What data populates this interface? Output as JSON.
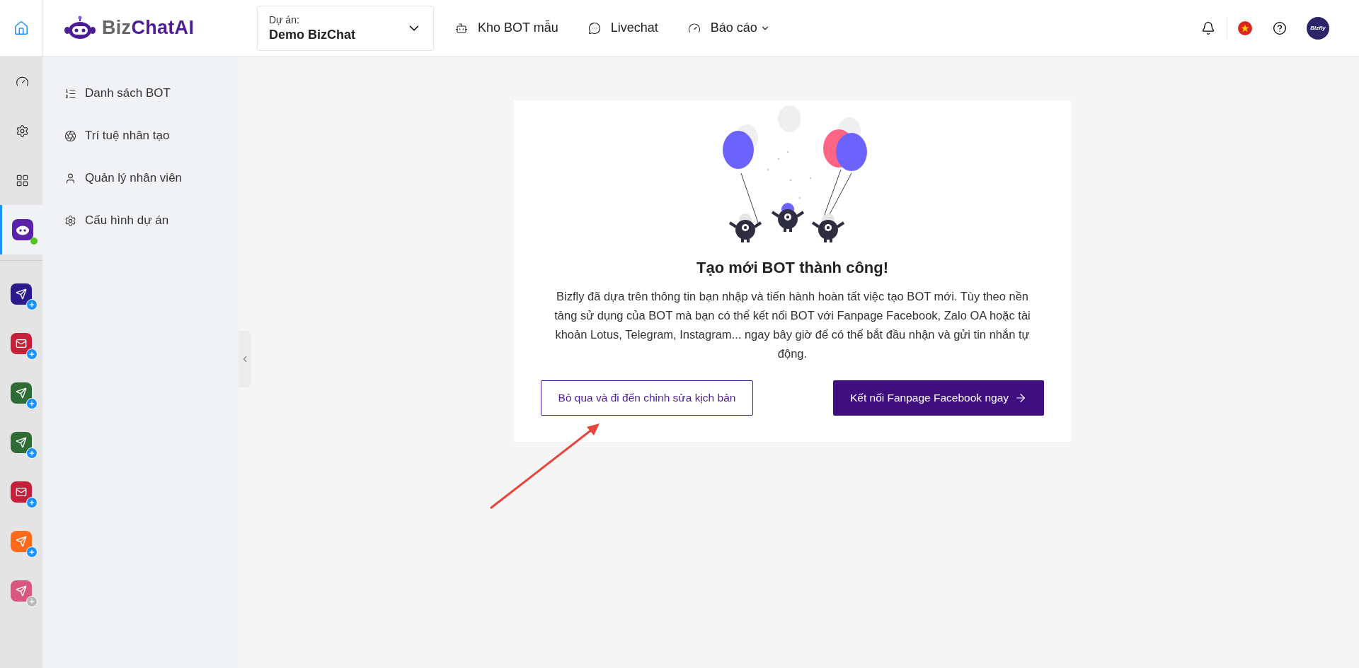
{
  "logo": {
    "prefix": "Biz",
    "suffix": "ChatAI"
  },
  "project_select": {
    "label": "Dự án:",
    "value": "Demo BizChat"
  },
  "top_nav": [
    {
      "label": "Kho BOT mẫu",
      "kind": "template",
      "dropdown": false
    },
    {
      "label": "Livechat",
      "kind": "chat",
      "dropdown": false
    },
    {
      "label": "Báo cáo",
      "kind": "report",
      "dropdown": true
    }
  ],
  "avatar": {
    "text": "Bizfly"
  },
  "rail": {
    "nav": [
      {
        "kind": "dashboard",
        "selected": false
      },
      {
        "kind": "settings",
        "selected": false
      },
      {
        "kind": "apps",
        "selected": false
      },
      {
        "kind": "bot",
        "selected": true,
        "online": true
      }
    ],
    "apps": [
      {
        "color": "#2a1a8c",
        "enabled": true
      },
      {
        "color": "#c4203a",
        "enabled": true
      },
      {
        "color": "#2e6b35",
        "enabled": true
      },
      {
        "color": "#2e6b35",
        "enabled": true
      },
      {
        "color": "#c4203a",
        "enabled": true
      },
      {
        "color": "#ff6a1a",
        "enabled": true
      },
      {
        "color": "#d9567f",
        "enabled": false
      }
    ]
  },
  "sidebar": {
    "items": [
      {
        "label": "Danh sách BOT",
        "kind": "list"
      },
      {
        "label": "Trí tuệ nhân tạo",
        "kind": "ai"
      },
      {
        "label": "Quản lý nhân viên",
        "kind": "user"
      },
      {
        "label": "Cấu hình dự án",
        "kind": "settings"
      }
    ]
  },
  "card": {
    "title": "Tạo mới BOT thành công!",
    "text": "Bizfly đã dựa trên thông tin bạn nhập và tiến hành hoàn tất việc tạo BOT mới. Tùy theo nền tảng sử dụng của BOT mà bạn có thể kết nối BOT với Fanpage Facebook, Zalo OA hoặc tài khoản Lotus, Telegram, Instagram... ngay bây giờ để có thể bắt đầu nhận và gửi tin nhắn tự động.",
    "secondary_button": "Bỏ qua và đi đến chỉnh sửa kịch bản",
    "primary_button": "Kết nối Fanpage Facebook ngay"
  }
}
